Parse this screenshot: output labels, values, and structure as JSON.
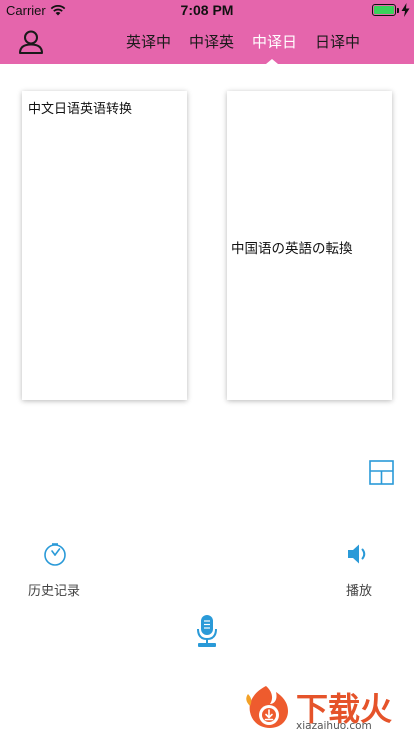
{
  "status_bar": {
    "carrier": "Carrier",
    "time": "7:08 PM",
    "battery_color": "#3ad25a"
  },
  "header": {
    "background": "#e565ac",
    "user_icon": "person-outline-icon",
    "tabs": [
      {
        "label": "英译中",
        "active": false
      },
      {
        "label": "中译英",
        "active": false
      },
      {
        "label": "中译日",
        "active": true
      },
      {
        "label": "日译中",
        "active": false
      }
    ]
  },
  "source_panel": {
    "text": "中文日语英语转换"
  },
  "target_panel": {
    "text": "中国语の英語の転換"
  },
  "controls": {
    "layout_icon": "split-layout-icon",
    "history": {
      "icon": "clock-icon",
      "label": "历史记录"
    },
    "play": {
      "icon": "speaker-icon",
      "label": "播放"
    },
    "mic": {
      "icon": "microphone-icon"
    },
    "accent": "#2a9ad8"
  },
  "watermark": {
    "title": "下载火",
    "subtitle": "xiazaihuo.com",
    "color": "#e5532a"
  }
}
